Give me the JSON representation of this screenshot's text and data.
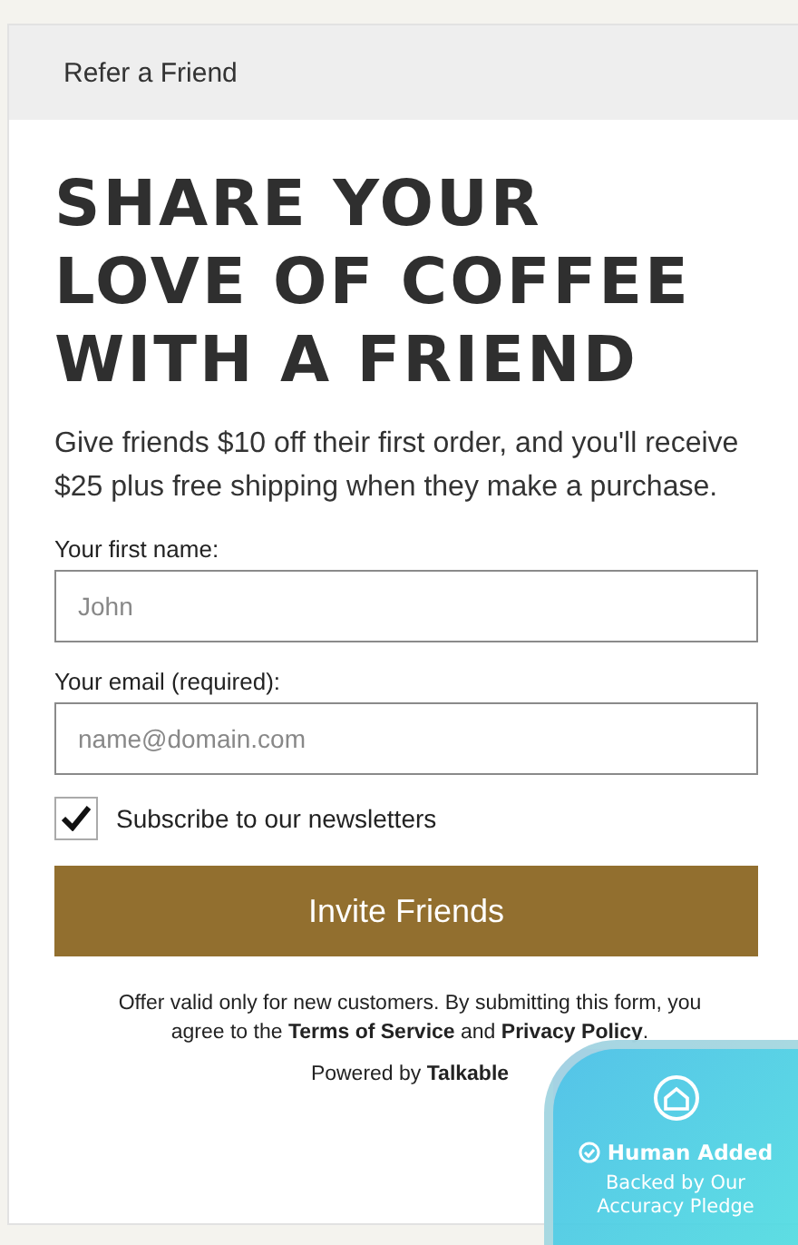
{
  "header": {
    "title": "Refer a Friend"
  },
  "heading": "SHARE YOUR LOVE OF COFFEE WITH A FRIEND",
  "intro": "Give friends $10 off their first order, and you'll receive $25 plus free shipping when they make a purchase.",
  "fields": [
    {
      "label": "Your first name:",
      "placeholder": "John"
    },
    {
      "label": "Your email (required):",
      "placeholder": "name@domain.com"
    }
  ],
  "newsletter": {
    "label": "Subscribe to our newsletters",
    "checked": true
  },
  "submit": "Invite Friends",
  "terms": {
    "before": "Offer valid only for new customers. By submitting this form, you agree to the",
    "terms_link": "Terms of Service",
    "between": "and",
    "privacy_link": "Privacy Policy",
    "after": "."
  },
  "powered": {
    "prefix": "Powered by",
    "brand": "Talkable"
  },
  "badge": {
    "title": "Human Added",
    "subtitle": "Backed by Our Accuracy Pledge"
  }
}
